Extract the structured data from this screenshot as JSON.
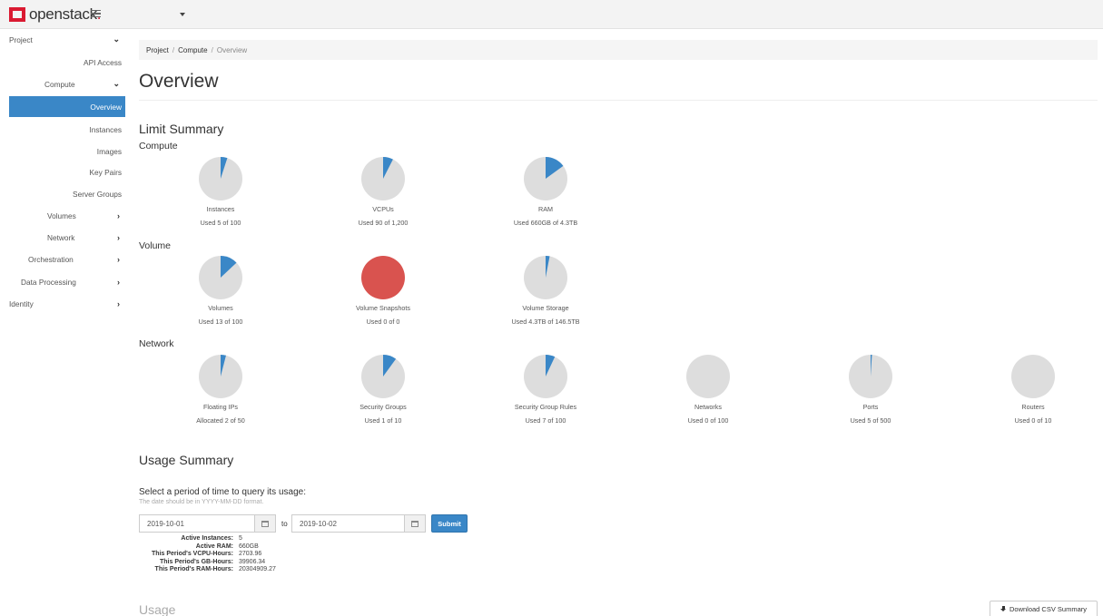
{
  "header": {
    "logo_text": "openstack",
    "logo_dot": "."
  },
  "sidebar": {
    "items": [
      {
        "label": "Project",
        "chevron": "⌄"
      },
      {
        "label": "API Access"
      },
      {
        "label": "Compute",
        "chevron": "⌄"
      },
      {
        "label": "Overview"
      },
      {
        "label": "Instances"
      },
      {
        "label": "Images"
      },
      {
        "label": "Key Pairs"
      },
      {
        "label": "Server Groups"
      },
      {
        "label": "Volumes",
        "chevron": "›"
      },
      {
        "label": "Network",
        "chevron": "›"
      },
      {
        "label": "Orchestration",
        "chevron": "›"
      },
      {
        "label": "Data Processing",
        "chevron": "›"
      },
      {
        "label": "Identity",
        "chevron": "›"
      }
    ]
  },
  "breadcrumb": {
    "project": "Project",
    "compute": "Compute",
    "current": "Overview",
    "sep": "/"
  },
  "page": {
    "title": "Overview",
    "limit_summary": "Limit Summary",
    "compute_heading": "Compute",
    "volume_heading": "Volume",
    "network_heading": "Network"
  },
  "limits": {
    "compute": [
      {
        "label": "Instances",
        "used": "Used 5 of 100",
        "fraction": 0.05
      },
      {
        "label": "VCPUs",
        "used": "Used 90 of 1,200",
        "fraction": 0.075
      },
      {
        "label": "RAM",
        "used": "Used 660GB of 4.3TB",
        "fraction": 0.15
      }
    ],
    "volume": [
      {
        "label": "Volumes",
        "used": "Used 13 of 100",
        "fraction": 0.13
      },
      {
        "label": "Volume Snapshots",
        "used": "Used 0 of 0",
        "fraction": 1.0,
        "full": true
      },
      {
        "label": "Volume Storage",
        "used": "Used 4.3TB of 146.5TB",
        "fraction": 0.03
      }
    ],
    "network": [
      {
        "label": "Floating IPs",
        "used": "Allocated 2 of 50",
        "fraction": 0.04
      },
      {
        "label": "Security Groups",
        "used": "Used 1 of 10",
        "fraction": 0.1
      },
      {
        "label": "Security Group Rules",
        "used": "Used 7 of 100",
        "fraction": 0.07
      },
      {
        "label": "Networks",
        "used": "Used 0 of 100",
        "fraction": 0
      },
      {
        "label": "Ports",
        "used": "Used 5 of 500",
        "fraction": 0.01
      },
      {
        "label": "Routers",
        "used": "Used 0 of 10",
        "fraction": 0
      }
    ]
  },
  "colors": {
    "pie_bg": "#dddddd",
    "pie_used": "#3a87c7",
    "pie_full": "#d9534f",
    "accent": "#3a87c7",
    "brand": "#da1a32"
  },
  "usage": {
    "heading": "Usage Summary",
    "query_label": "Select a period of time to query its usage:",
    "hint": "The date should be in YYYY-MM-DD format.",
    "start_date": "2019-10-01",
    "end_date": "2019-10-02",
    "to_label": "to",
    "submit_label": "Submit",
    "stats": [
      {
        "key": "Active Instances:",
        "value": "5"
      },
      {
        "key": "Active RAM:",
        "value": "660GB"
      },
      {
        "key": "This Period's VCPU-Hours:",
        "value": "2703.96"
      },
      {
        "key": "This Period's GB-Hours:",
        "value": "39906.34"
      },
      {
        "key": "This Period's RAM-Hours:",
        "value": "20304909.27"
      }
    ],
    "usage_heading": "Usage",
    "csv_label": "Download CSV Summary"
  }
}
